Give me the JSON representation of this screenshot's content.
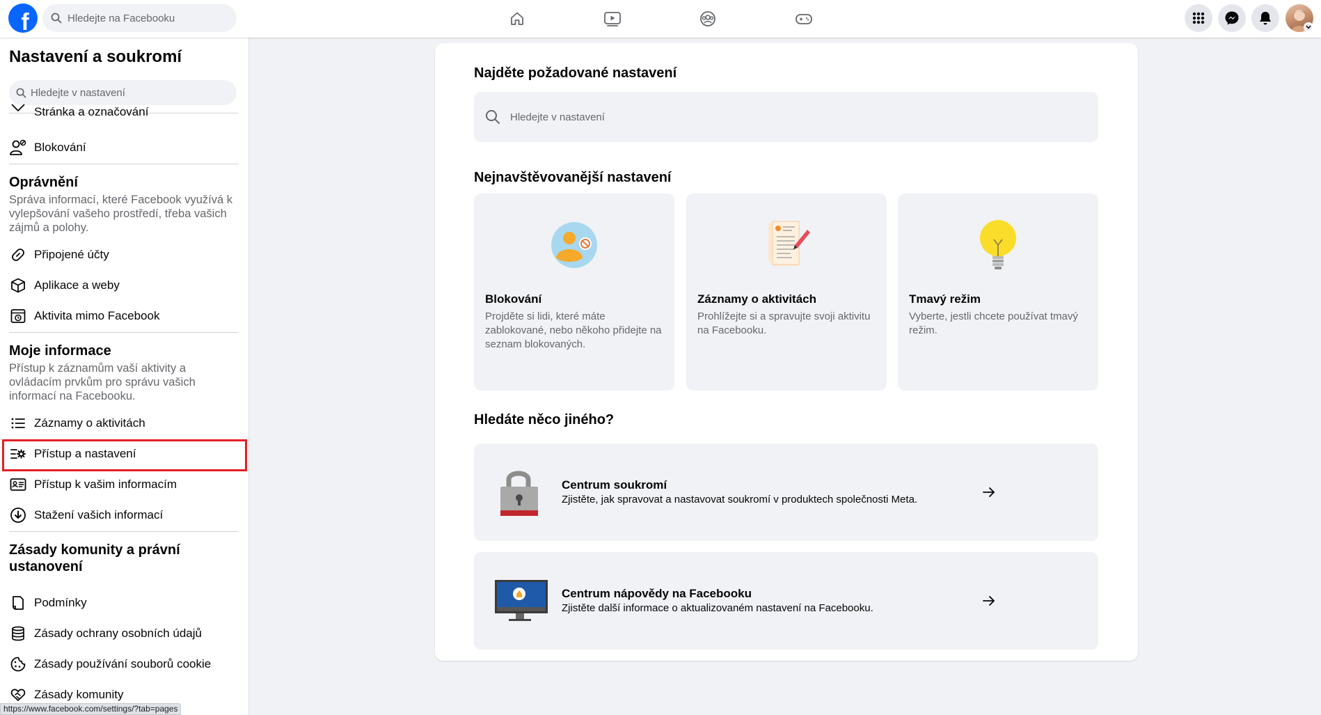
{
  "topbar": {
    "search_placeholder": "Hledejte na Facebooku",
    "nav_icons": [
      "home-icon",
      "video-icon",
      "groups-icon",
      "gaming-icon"
    ],
    "right_icons": [
      "menu-grid-icon",
      "messenger-icon",
      "notifications-icon"
    ]
  },
  "sidebar": {
    "title": "Nastavení a soukromí",
    "search_placeholder": "Hledejte v nastavení",
    "items_top": [
      {
        "label": "Stránka a označování",
        "icon": "tag-icon"
      },
      {
        "label": "Blokování",
        "icon": "block-user-icon"
      }
    ],
    "permissions": {
      "title": "Oprávnění",
      "desc": "Správa informací, které Facebook využívá k vylepšování vašeho prostředí, třeba vašich zájmů a polohy.",
      "items": [
        {
          "label": "Připojené účty",
          "icon": "link-icon"
        },
        {
          "label": "Aplikace a weby",
          "icon": "cube-icon"
        },
        {
          "label": "Aktivita mimo Facebook",
          "icon": "off-facebook-activity-icon"
        }
      ]
    },
    "my_info": {
      "title": "Moje informace",
      "desc": "Přístup k záznamům vaší aktivity a ovládacím prvkům pro správu vašich informací na Facebooku.",
      "items": [
        {
          "label": "Záznamy o aktivitách",
          "icon": "list-icon"
        },
        {
          "label": "Přístup a nastavení",
          "icon": "settings-sliders-icon"
        },
        {
          "label": "Přístup k vašim informacím",
          "icon": "id-card-icon"
        },
        {
          "label": "Stažení vašich informací",
          "icon": "download-icon"
        }
      ]
    },
    "policies": {
      "title": "Zásady komunity a právní ustanovení",
      "items": [
        {
          "label": "Podmínky",
          "icon": "document-icon"
        },
        {
          "label": "Zásady ochrany osobních údajů",
          "icon": "database-icon"
        },
        {
          "label": "Zásady používání souborů cookie",
          "icon": "cookie-icon"
        },
        {
          "label": "Zásady komunity",
          "icon": "handshake-icon"
        }
      ]
    }
  },
  "status_url": "https://www.facebook.com/settings/?tab=pages",
  "main": {
    "find_title": "Najděte požadované nastavení",
    "search_placeholder": "Hledejte v nastavení",
    "most_visited_title": "Nejnavštěvovanější nastavení",
    "cards": [
      {
        "title": "Blokování",
        "desc": "Projděte si lidi, které máte zablokované, nebo někoho přidejte na seznam blokovaných.",
        "icon": "blocking-illustration-icon"
      },
      {
        "title": "Záznamy o aktivitách",
        "desc": "Prohlížejte si a spravujte svoji aktivitu na Facebooku.",
        "icon": "activity-log-illustration-icon"
      },
      {
        "title": "Tmavý režim",
        "desc": "Vyberte, jestli chcete používat tmavý režim.",
        "icon": "lightbulb-illustration-icon"
      }
    ],
    "other_title": "Hledáte něco jiného?",
    "wide_cards": [
      {
        "title": "Centrum soukromí",
        "desc": "Zjistěte, jak spravovat a nastavovat soukromí v produktech společnosti Meta.",
        "icon": "padlock-illustration-icon"
      },
      {
        "title": "Centrum nápovědy na Facebooku",
        "desc": "Zjistěte další informace o aktualizovaném nastavení na Facebooku.",
        "icon": "monitor-illustration-icon"
      }
    ]
  },
  "colors": {
    "brand": "#0866ff",
    "highlight": "#e41e26",
    "background": "#f0f2f5"
  }
}
